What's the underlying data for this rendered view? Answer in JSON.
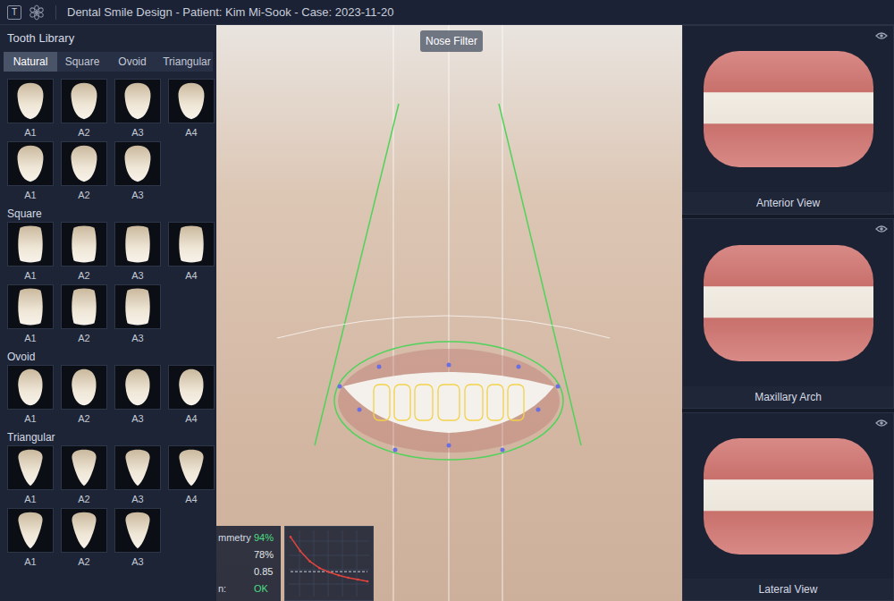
{
  "window": {
    "icon_text": "T",
    "title": "Dental Smile Design - Patient: Kim Mi-Sook - Case: 2023-11-20"
  },
  "library": {
    "title": "Tooth Library",
    "tabs": [
      {
        "label": "Natural",
        "selected": true
      },
      {
        "label": "Square",
        "selected": false
      },
      {
        "label": "Ovoid",
        "selected": false
      },
      {
        "label": "Triangular",
        "selected": false
      }
    ],
    "groups": [
      {
        "kind": "natural",
        "rows": [
          [
            "A1",
            "A2",
            "A3",
            "A4"
          ],
          [
            "A1",
            "A2",
            "A3"
          ]
        ]
      },
      {
        "title": "Square",
        "kind": "square",
        "rows": [
          [
            "A1",
            "A2",
            "A3",
            "A4"
          ],
          [
            "A1",
            "A2",
            "A3"
          ]
        ]
      },
      {
        "title": "Ovoid",
        "kind": "ovoid",
        "rows": [
          [
            "A1",
            "A2",
            "A3",
            "A4"
          ]
        ]
      },
      {
        "title": "Triangular",
        "kind": "triangular",
        "rows": [
          [
            "A1",
            "A2",
            "A3",
            "A4"
          ],
          [
            "A1",
            "A2",
            "A3"
          ]
        ]
      }
    ]
  },
  "canvas": {
    "filter_label": "Nose Filter",
    "metrics": [
      {
        "label": "mmetry",
        "value": "94%",
        "color": "#4ade80"
      },
      {
        "value": "78%",
        "color": "#e5e7eb"
      },
      {
        "value": "0.85",
        "color": "#e5e7eb"
      },
      {
        "label": "n:",
        "value": "OK",
        "color": "#4ade80"
      }
    ],
    "chart": {
      "series": [
        0.95,
        0.72,
        0.55,
        0.44,
        0.37,
        0.32,
        0.28,
        0.25,
        0.22
      ],
      "threshold": 0.38
    }
  },
  "views": [
    {
      "label": "Anterior View",
      "visible": true
    },
    {
      "label": "Maxillary Arch",
      "visible": true
    },
    {
      "label": "Lateral View",
      "visible": true
    }
  ]
}
